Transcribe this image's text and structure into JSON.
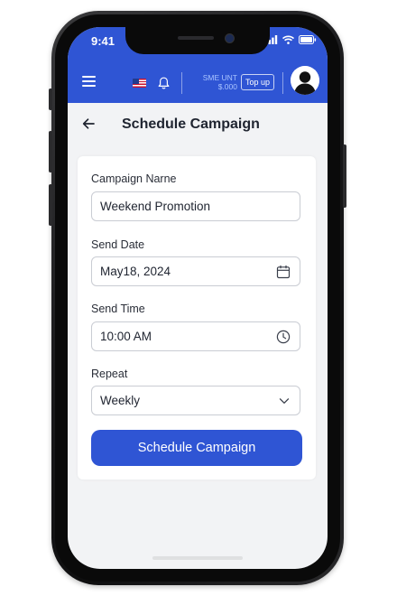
{
  "status": {
    "time": "9:41"
  },
  "appbar": {
    "flag_icon": "us-flag-icon",
    "balance_label": "SME UNT",
    "balance_value": "$.000",
    "topup_label": "Top up",
    "accent_color": "#2f55d4"
  },
  "header": {
    "title": "Schedule Campaign"
  },
  "form": {
    "campaign_name": {
      "label": "Campaign Narne",
      "value": "Weekend Promotion"
    },
    "send_date": {
      "label": "Send Date",
      "value": "May18, 2024",
      "icon": "calendar-icon"
    },
    "send_time": {
      "label": "Send Time",
      "value": "10:00 AM",
      "icon": "clock-icon"
    },
    "repeat": {
      "label": "Repeat",
      "value": "Weekly",
      "icon": "chevron-down-icon"
    },
    "submit_label": "Schedule Campaign"
  }
}
